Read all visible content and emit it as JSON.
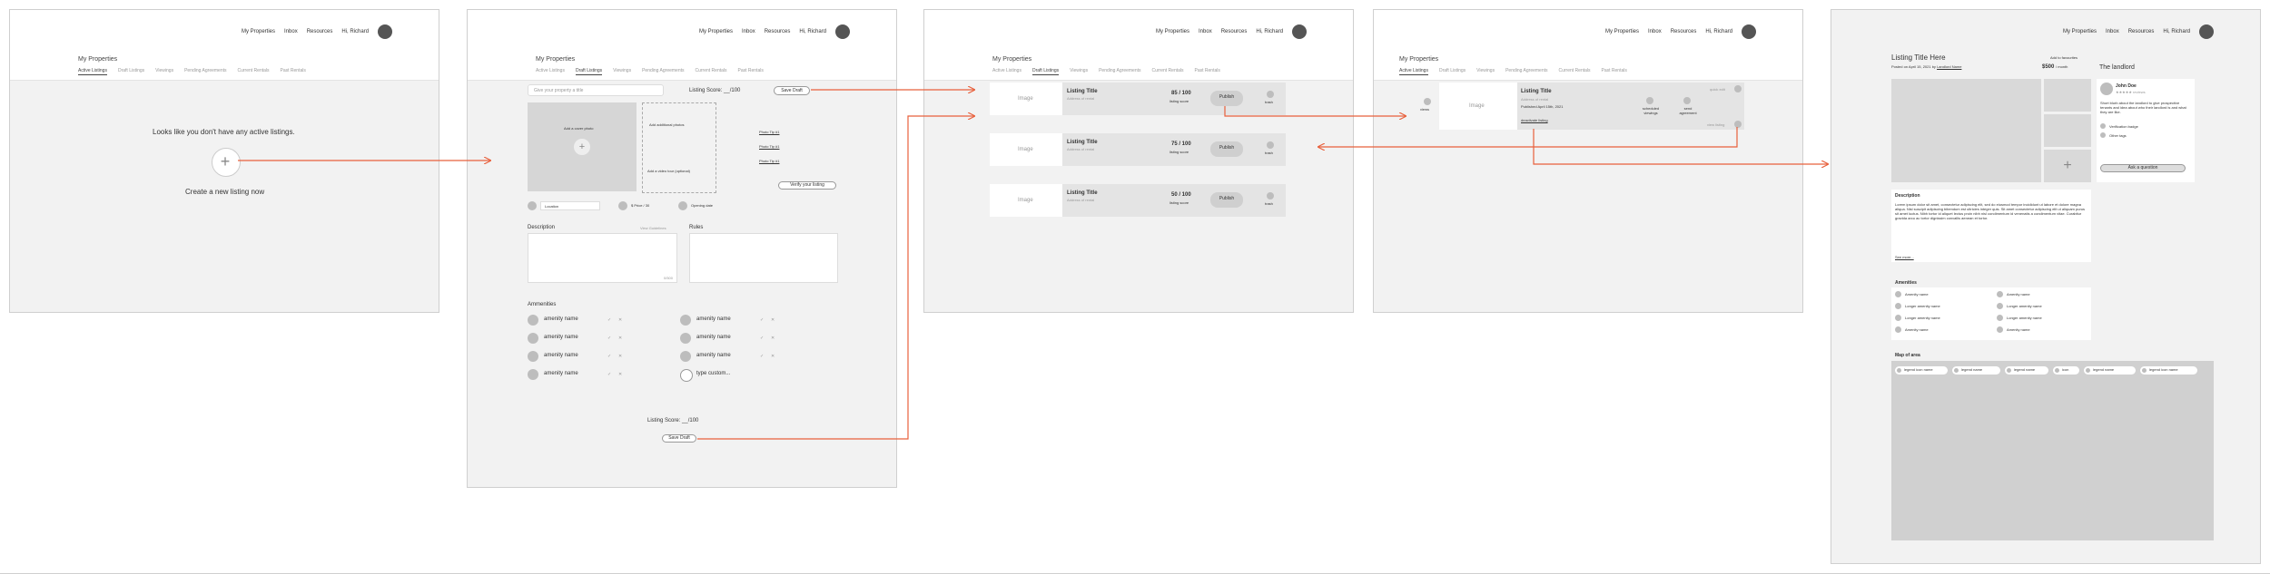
{
  "nav": {
    "my_properties": "My Properties",
    "inbox": "Inbox",
    "resources": "Resources",
    "greeting": "Hi, Richard"
  },
  "page_title": "My Properties",
  "tabs": [
    "Active Listings",
    "Draft Listings",
    "Viewings",
    "Pending Agreements",
    "Current Rentals",
    "Past Rentals"
  ],
  "screen1": {
    "empty_text": "Looks like you don't have any active listings.",
    "create_text": "Create a new listing now"
  },
  "screen2": {
    "title_placeholder": "Give your property a title",
    "score_top": "Listing Score: __/100",
    "save_draft": "Save Draft",
    "cover_photo": "Add a cover photo",
    "add_photos": "Add additional photos",
    "photo_tip": "Photo Tip #1",
    "add_video": "Add a video tour (optional)",
    "verify": "Verify your listing",
    "location": "Location",
    "price": "$ Price / 30",
    "opening_date": "Opening date",
    "description": "Description",
    "desc_hint": "View Guidelines",
    "desc_count": "0/500",
    "rules": "Rules",
    "amenities_title": "Ammenities",
    "amenity": "amenity name",
    "custom": "type custom...",
    "score_bottom": "Listing Score: __/100",
    "save_draft_bottom": "Save Draft"
  },
  "draft": {
    "image": "Image",
    "listing_title": "Listing Title",
    "address": "Address of rental",
    "score_label": "listing score",
    "publish": "Publish",
    "trash": "trash",
    "scores": [
      "85 / 100",
      "75 / 100",
      "50 / 100"
    ]
  },
  "active": {
    "image": "Image",
    "views": "views",
    "listing_title": "Listing Title",
    "address": "Address of rental",
    "published": "Published April 15th, 2021",
    "deactivate": "deactivate listing",
    "viewings": "scheduled viewings",
    "agreement": "send agreement",
    "quick_edit": "quick edit",
    "view_listing": "view listing"
  },
  "detail": {
    "title": "Listing Title Here",
    "posted": "Posted on April 15, 2021 by",
    "landlord_link": "Landlord Name",
    "favorite": "Add to favourites",
    "price": "$500",
    "per": "/ month",
    "landlord_heading": "The landlord",
    "landlord_name": "John Doe",
    "landlord_reviews": "★★★★★ reviews",
    "landlord_bio": "Short blurb about the landlord to give prospective tenants and idea about who their landlord is and what they are like.",
    "verification": "Verification badge",
    "other_tags": "Other tags",
    "contact": "Ask a question",
    "description_title": "Description",
    "desc_text": "Lorem ipsum dolor sit amet, consectetur adipiscing elit, sed do eiusmod tempor incididunt ut labore et dolore magna aliqua. Nisl suscipit adipiscing bibendum est ultricies integer quis. Sit amet consectetur adipiscing elit ut aliquam purus sit amet luctus. Nibh tortor id aliquet lectus proin nibh nisl condimentum id venenatis a condimentum vitae. Curabitur gravida arcu ac tortor dignissim convallis aenean et tortor.",
    "see_more": "See more...",
    "amenities_title": "Amenities",
    "amenities": [
      "Amenity name",
      "Amenity name",
      "Longer amenity name",
      "Longer amenity name",
      "Longer amenity name",
      "Longer amenity name",
      "Amenity name",
      "Amenity name"
    ],
    "map_title": "Map of area",
    "legend": [
      "legend icon name",
      "legend name",
      "legend name",
      "icon",
      "legend name",
      "legend icon name"
    ]
  }
}
